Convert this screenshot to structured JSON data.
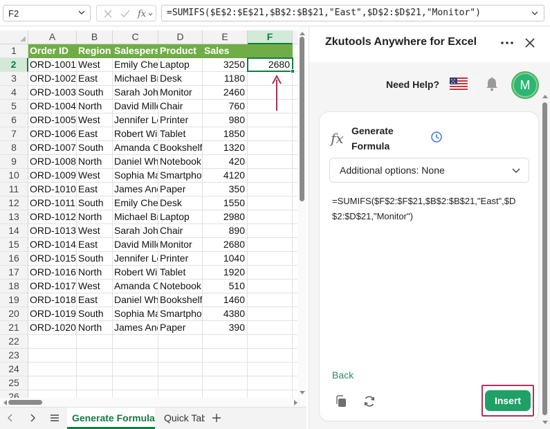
{
  "formula_bar": {
    "name_box": "F2",
    "formula": "=SUMIFS($E$2:$E$21,$B$2:$B$21,\"East\",$D$2:$D$21,\"Monitor\")",
    "cancel_icon": "x-icon",
    "enter_icon": "checkmark-icon",
    "function_icon": "fx-icon"
  },
  "sheet": {
    "columns": [
      "A",
      "B",
      "C",
      "D",
      "E",
      "F"
    ],
    "selected_column": "F",
    "selected_row": "2",
    "headers": [
      "Order ID",
      "Region",
      "Salesperson",
      "Product",
      "Sales"
    ],
    "rows": [
      [
        "ORD-1001",
        "West",
        "Emily Chen",
        "Laptop",
        "3250"
      ],
      [
        "ORD-1002",
        "East",
        "Michael Brown",
        "Desk",
        "1180"
      ],
      [
        "ORD-1003",
        "South",
        "Sarah Johnson",
        "Monitor",
        "2460"
      ],
      [
        "ORD-1004",
        "North",
        "David Miller",
        "Chair",
        "760"
      ],
      [
        "ORD-1005",
        "West",
        "Jennifer Lee",
        "Printer",
        "980"
      ],
      [
        "ORD-1006",
        "East",
        "Robert Wilson",
        "Tablet",
        "1850"
      ],
      [
        "ORD-1007",
        "South",
        "Amanda Clark",
        "Bookshelf",
        "1320"
      ],
      [
        "ORD-1008",
        "North",
        "Daniel White",
        "Notebook",
        "420"
      ],
      [
        "ORD-1009",
        "West",
        "Sophia Martinez",
        "Smartphone",
        "4120"
      ],
      [
        "ORD-1010",
        "East",
        "James Anderson",
        "Paper",
        "350"
      ],
      [
        "ORD-1011",
        "South",
        "Emily Chen",
        "Desk",
        "1550"
      ],
      [
        "ORD-1012",
        "North",
        "Michael Brown",
        "Laptop",
        "2980"
      ],
      [
        "ORD-1013",
        "West",
        "Sarah Johnson",
        "Chair",
        "890"
      ],
      [
        "ORD-1014",
        "East",
        "David Miller",
        "Monitor",
        "2680"
      ],
      [
        "ORD-1015",
        "South",
        "Jennifer Lee",
        "Printer",
        "1040"
      ],
      [
        "ORD-1016",
        "North",
        "Robert Wilson",
        "Tablet",
        "1920"
      ],
      [
        "ORD-1017",
        "West",
        "Amanda Clark",
        "Notebook",
        "510"
      ],
      [
        "ORD-1018",
        "East",
        "Daniel White",
        "Bookshelf",
        "1460"
      ],
      [
        "ORD-1019",
        "South",
        "Sophia Martinez",
        "Smartphone",
        "4380"
      ],
      [
        "ORD-1020",
        "North",
        "James Anderson",
        "Paper",
        "390"
      ]
    ],
    "result_value": "2680",
    "row_numbers": [
      "1",
      "2",
      "3",
      "4",
      "5",
      "6",
      "7",
      "8",
      "9",
      "10",
      "11",
      "12",
      "13",
      "14",
      "15",
      "16",
      "17",
      "18",
      "19",
      "20",
      "21",
      "22",
      "23",
      "24",
      "25",
      "26"
    ],
    "header_fill": "#70ad47",
    "accent": "#107c41"
  },
  "tabs": {
    "items": [
      "Generate Formula",
      "Quick Table"
    ],
    "active": 0,
    "prev_icon": "chevron-left-icon",
    "next_icon": "chevron-right-icon",
    "menu_icon": "hamburger-icon",
    "add_icon": "plus-icon"
  },
  "pane": {
    "title": "Zkutools Anywhere for Excel",
    "more_icon": "more-dots-icon",
    "close_icon": "close-icon",
    "need_help": "Need Help?",
    "language_icon": "us-flag-icon",
    "notifications_icon": "bell-icon",
    "avatar_letter": "M",
    "card": {
      "fx_symbol": "fx",
      "title": "Generate Formula",
      "history_icon": "clock-icon",
      "options_label": "Additional options: None",
      "formula": "=SUMIFS($F$2:$F$21,$B$2:$B$21,\"East\",$D$2:$D$21,\"Monitor\")",
      "back": "Back",
      "copy_icon": "copy-icon",
      "regenerate_icon": "refresh-icon",
      "insert": "Insert"
    },
    "insert_color": "#1fa067",
    "highlight_color": "#b0325b"
  }
}
